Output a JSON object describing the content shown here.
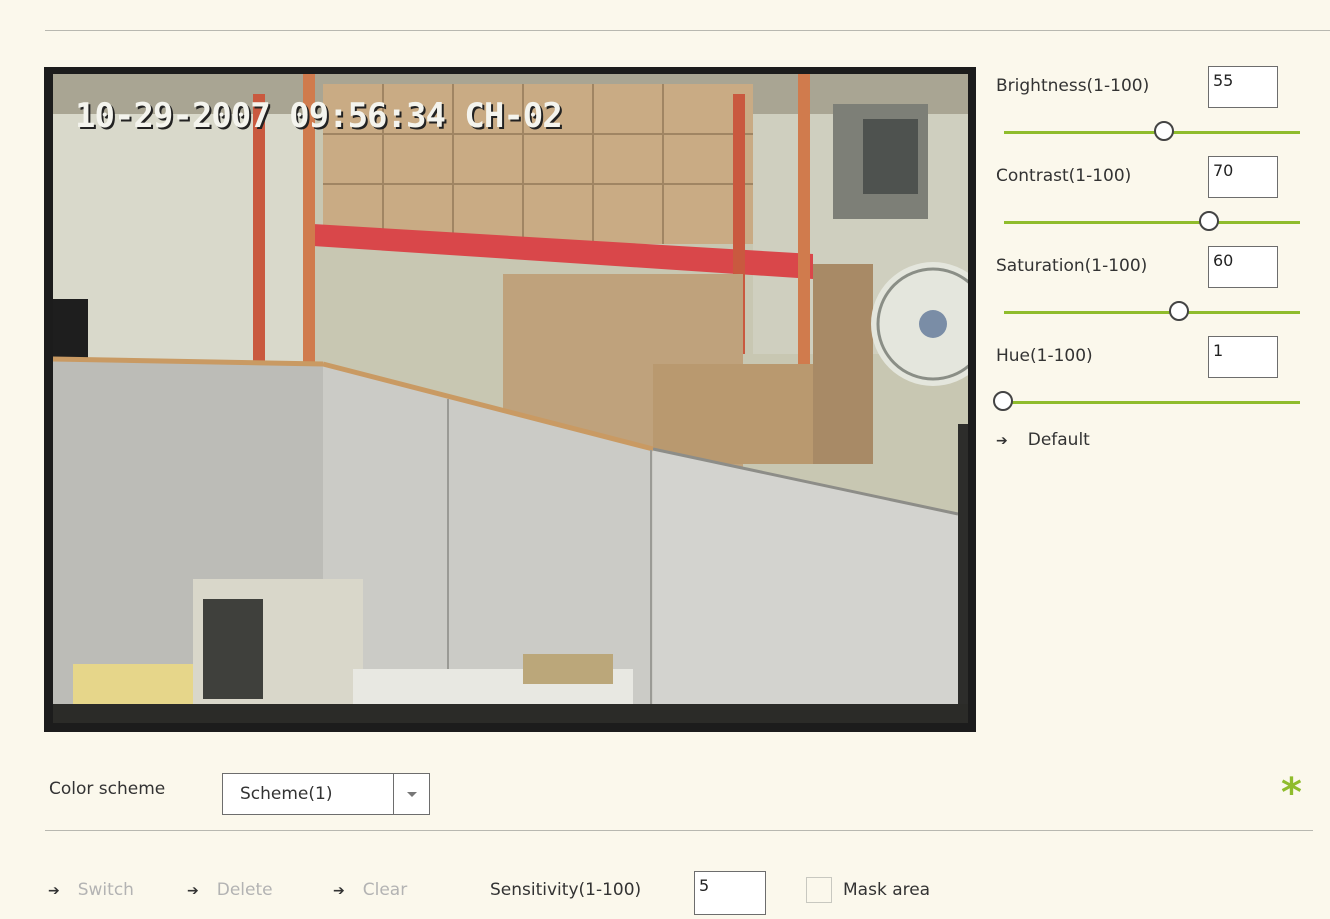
{
  "video": {
    "osd_text": "10-29-2007 09:56:34 CH-02"
  },
  "controls": [
    {
      "label": "Brightness(1-100)",
      "value": "55",
      "level": 55
    },
    {
      "label": "Contrast(1-100)",
      "value": "70",
      "level": 70
    },
    {
      "label": "Saturation(1-100)",
      "value": "60",
      "level": 60
    },
    {
      "label": "Hue(1-100)",
      "value": "1",
      "level": 1
    }
  ],
  "default_label": "Default",
  "color_scheme": {
    "label": "Color scheme",
    "selected": "Scheme(1)"
  },
  "toolbar": {
    "switch_label": "Switch",
    "delete_label": "Delete",
    "clear_label": "Clear"
  },
  "sensitivity": {
    "label": "Sensitivity(1-100)",
    "value": "5"
  },
  "mask": {
    "label": "Mask area",
    "checked": false
  },
  "colors": {
    "accent": "#8fbc2c",
    "background": "#fbf8ec",
    "disabled_text": "#b3b3b3"
  },
  "icons": [
    "arrow-right-icon",
    "star-icon",
    "chevron-down-icon"
  ]
}
